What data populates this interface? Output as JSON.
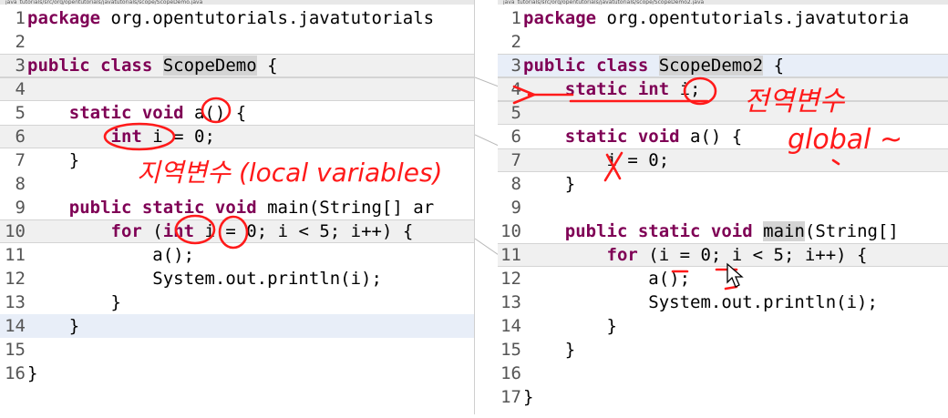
{
  "left_editor": {
    "path_text": "java_tutorials/src/org/opentutorials/javatutorials/scope/ScopeDemo.java",
    "lines": [
      {
        "n": "1",
        "html": "<span class=\"kw\">package</span> org.opentutorials.javatutorials"
      },
      {
        "n": "2",
        "html": ""
      },
      {
        "n": "3",
        "html": "<span class=\"kw\">public class</span> <span class=\"hl\">ScopeDemo</span> {"
      },
      {
        "n": "4",
        "html": ""
      },
      {
        "n": "5",
        "html": "    <span class=\"kw\">static void</span> a() {"
      },
      {
        "n": "6",
        "html": "        <span class=\"kw\">int</span> i = 0;"
      },
      {
        "n": "7",
        "html": "    }"
      },
      {
        "n": "8",
        "html": ""
      },
      {
        "n": "9",
        "html": "    <span class=\"kw\">public static void</span> main(String[] ar"
      },
      {
        "n": "10",
        "html": "        <span class=\"kw\">for</span> (<span class=\"kw\">int</span> i = 0; i < 5; i++) {"
      },
      {
        "n": "11",
        "html": "            a();"
      },
      {
        "n": "12",
        "html": "            System.out.println(i);"
      },
      {
        "n": "13",
        "html": "        }"
      },
      {
        "n": "14",
        "html": "    }"
      },
      {
        "n": "15",
        "html": ""
      },
      {
        "n": "16",
        "html": "}"
      }
    ],
    "annotation": "지역변수 (local variables)"
  },
  "right_editor": {
    "path_text": "java_tutorials/src/org/opentutorials/javatutorials/scope/ScopeDemo2.java",
    "lines": [
      {
        "n": "1",
        "html": "<span class=\"kw\">package</span> org.opentutorials.javatutoria"
      },
      {
        "n": "2",
        "html": ""
      },
      {
        "n": "3",
        "html": "<span class=\"kw\">public class</span> <span class=\"hl\">ScopeDemo2</span> {"
      },
      {
        "n": "4",
        "html": "    <span class=\"kw\">static int</span> i;"
      },
      {
        "n": "5",
        "html": ""
      },
      {
        "n": "6",
        "html": "    <span class=\"kw\">static void</span> a() {"
      },
      {
        "n": "7",
        "html": "        i = 0;"
      },
      {
        "n": "8",
        "html": "    }"
      },
      {
        "n": "9",
        "html": ""
      },
      {
        "n": "10",
        "html": "    <span class=\"kw\">public static void</span> <span class=\"hl\">main</span>(String[]"
      },
      {
        "n": "11",
        "html": "        <span class=\"kw\">for</span> (i = 0; i < 5; i++) {"
      },
      {
        "n": "12",
        "html": "            a();"
      },
      {
        "n": "13",
        "html": "            System.out.println(i);"
      },
      {
        "n": "14",
        "html": "        }"
      },
      {
        "n": "15",
        "html": "    }"
      },
      {
        "n": "16",
        "html": ""
      },
      {
        "n": "17",
        "html": "}"
      }
    ],
    "annotation_kr": "전역변수",
    "annotation_en": "global ~"
  },
  "colors": {
    "keyword": "#7f0055",
    "ink": "#ff1a1a",
    "highlight": "#d4d4d4"
  }
}
